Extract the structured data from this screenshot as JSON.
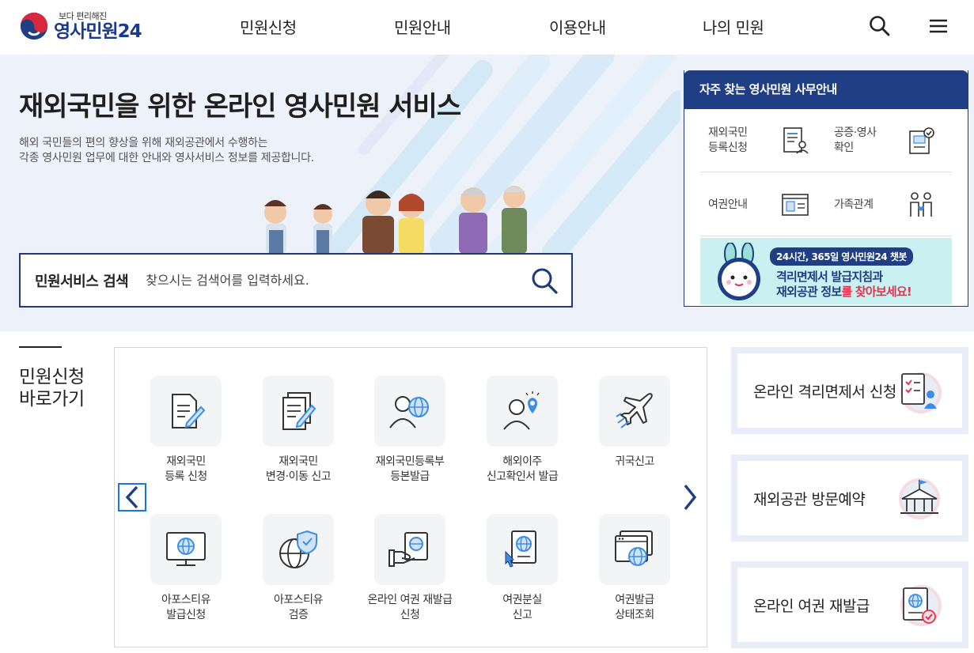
{
  "header": {
    "logo_tagline": "보다 편리해진",
    "logo_name": "영사민원",
    "logo_number": "24",
    "nav": [
      "민원신청",
      "민원안내",
      "이용안내",
      "나의 민원"
    ],
    "icons": [
      "search-icon",
      "menu-icon"
    ]
  },
  "hero": {
    "title": "재외국민을 위한 온라인 영사민원 서비스",
    "desc_line1": "해외 국민들의 편의 향상을 위해 재외공관에서 수행하는",
    "desc_line2": "각종 영사민원 업무에 대한 안내와 영사서비스 정보를 제공합니다.",
    "search_label": "민원서비스 검색",
    "search_placeholder": "찾으시는 검색어를 입력하세요."
  },
  "office_panel": {
    "title": "자주 찾는 영사민원 사무안내",
    "items": [
      {
        "label_line1": "재외국민",
        "label_line2": "등록신청",
        "icon": "document-person-icon"
      },
      {
        "label_line1": "공증·영사",
        "label_line2": "확인",
        "icon": "certificate-check-icon"
      },
      {
        "label_line1": "여권안내",
        "label_line2": "",
        "icon": "passport-id-icon"
      },
      {
        "label_line1": "가족관계",
        "label_line2": "",
        "icon": "family-icon"
      }
    ],
    "chatbot": {
      "pill": "24시간, 365일 영사민원24 챗봇",
      "line1": "격리면제서 발급지침과",
      "line2_bold": "재외공관 정보",
      "line2_rest": "를 찾아보세요!"
    }
  },
  "quick": {
    "title_line1": "민원신청",
    "title_line2": "바로가기",
    "items": [
      {
        "l1": "재외국민",
        "l2": "등록 신청",
        "icon": "document-pen-icon"
      },
      {
        "l1": "재외국민",
        "l2": "변경·이동 신고",
        "icon": "documents-pen-icon"
      },
      {
        "l1": "재외국민등록부",
        "l2": "등본발급",
        "icon": "person-globe-icon"
      },
      {
        "l1": "해외이주",
        "l2": "신고확인서 발급",
        "icon": "person-location-icon"
      },
      {
        "l1": "귀국신고",
        "l2": "",
        "icon": "airplane-icon"
      },
      {
        "l1": "아포스티유",
        "l2": "발급신청",
        "icon": "monitor-globe-icon"
      },
      {
        "l1": "아포스티유",
        "l2": "검증",
        "icon": "globe-shield-icon"
      },
      {
        "l1": "온라인 여권 재발급",
        "l2": "신청",
        "icon": "hand-passport-icon"
      },
      {
        "l1": "여권분실",
        "l2": "신고",
        "icon": "passport-cursor-icon"
      },
      {
        "l1": "여권발급",
        "l2": "상태조회",
        "icon": "window-globe-icon"
      }
    ]
  },
  "side_cards": [
    {
      "label": "온라인 격리면제서 신청",
      "icon": "checklist-person-icon"
    },
    {
      "label": "재외공관 방문예약",
      "icon": "embassy-building-icon"
    },
    {
      "label": "온라인 여권 재발급",
      "icon": "passport-check-icon"
    }
  ],
  "colors": {
    "brand": "#1f3e84",
    "hero_bg": "#edf1f9",
    "accent_blue": "#3a8ee6",
    "accent_red": "#e3324f"
  }
}
